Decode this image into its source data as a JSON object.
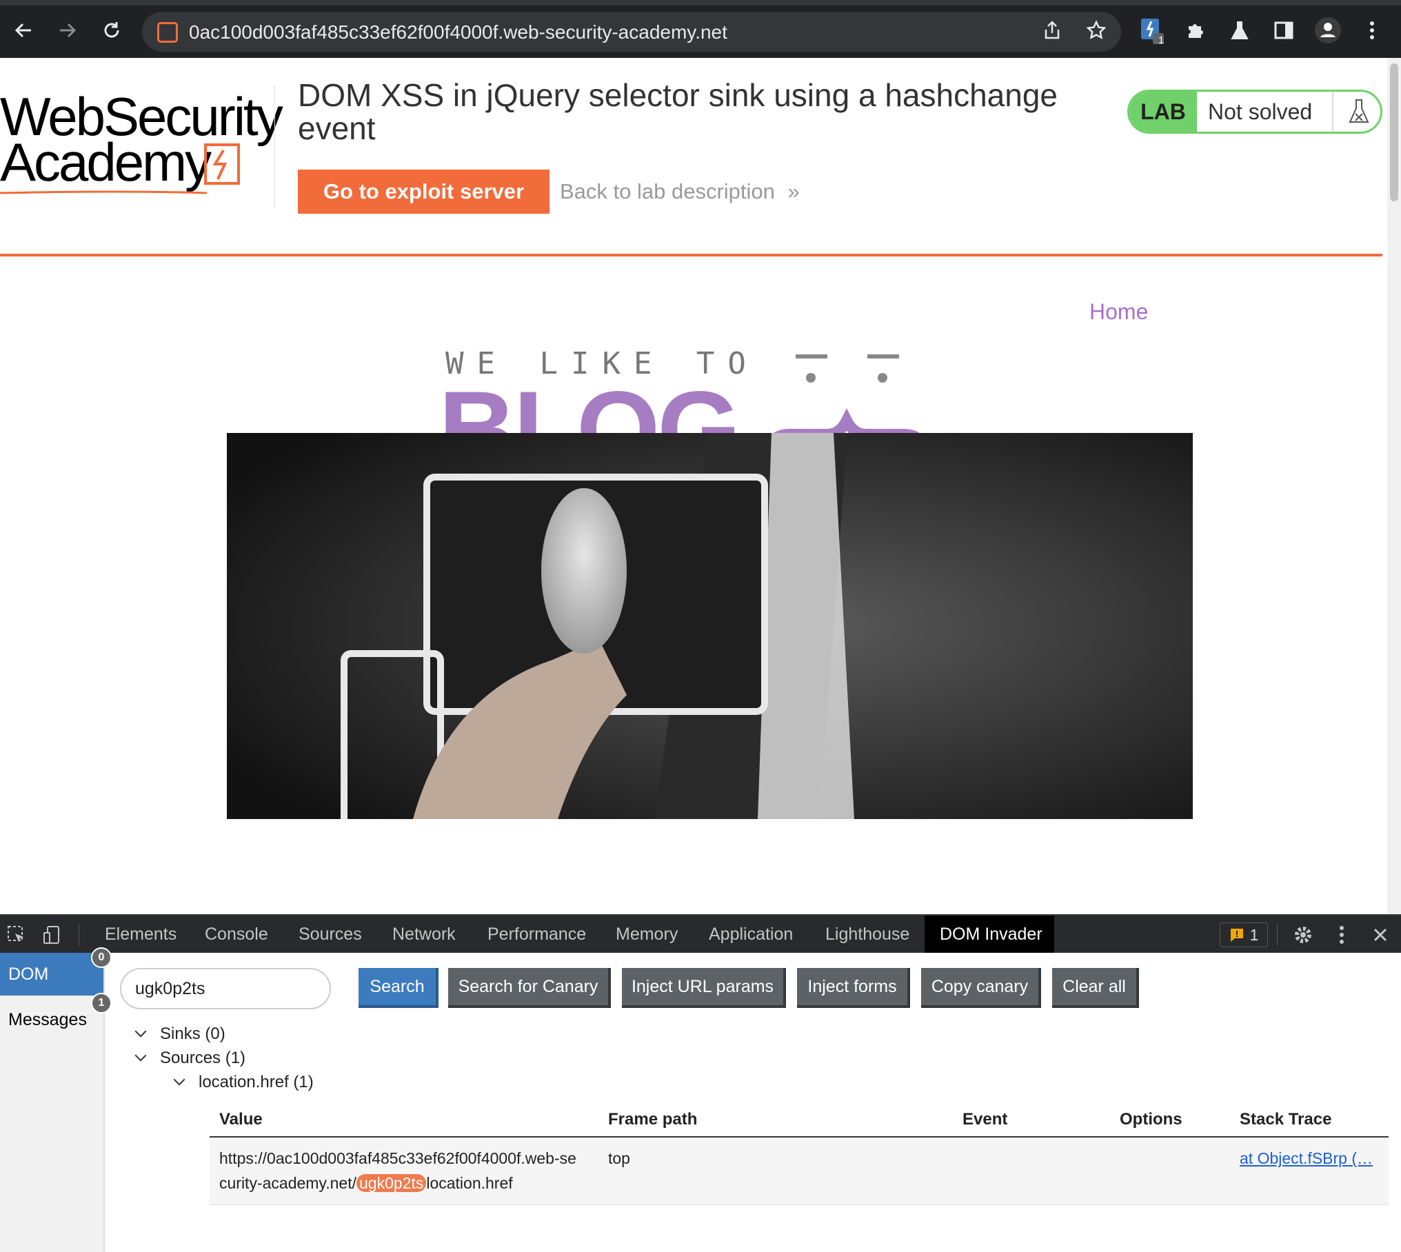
{
  "browser": {
    "url": "0ac100d003faf485c33ef62f00f4000f.web-security-academy.net",
    "extension_badge": "1",
    "icons": [
      "back-icon",
      "forward-icon",
      "reload-icon",
      "share-icon",
      "star-icon",
      "extension-icon",
      "puzzle-icon",
      "flask-icon",
      "sidepanel-icon",
      "profile-icon",
      "menu-icon"
    ]
  },
  "header": {
    "logo_line1": "WebSecurity",
    "logo_line2": "Academy",
    "lab_title": "DOM XSS in jQuery selector sink using a hashchange event",
    "exploit_button": "Go to exploit server",
    "back_link": "Back to lab description",
    "back_link_icon": "»",
    "lab_badge": "LAB",
    "lab_state": "Not solved"
  },
  "blog": {
    "nav_home": "Home",
    "tagline_small": "WE LIKE TO",
    "tagline_big": "BLOG"
  },
  "devtools": {
    "tabs": [
      "Elements",
      "Console",
      "Sources",
      "Network",
      "Performance",
      "Memory",
      "Application",
      "Lighthouse",
      "DOM Invader"
    ],
    "active_tab": "DOM Invader",
    "issues_count": "1",
    "sidebar": [
      {
        "label": "DOM",
        "count": "0"
      },
      {
        "label": "Messages",
        "count": "1"
      }
    ],
    "canary_value": "ugk0p2ts",
    "buttons": {
      "search": "Search",
      "search_canary": "Search for Canary",
      "inject_url": "Inject URL params",
      "inject_forms": "Inject forms",
      "copy_canary": "Copy canary",
      "clear_all": "Clear all"
    },
    "tree": {
      "sinks": "Sinks (0)",
      "sources": "Sources (1)",
      "location_href": "location.href (1)"
    },
    "columns": [
      "Value",
      "Frame path",
      "Event",
      "Options",
      "Stack Trace"
    ],
    "row": {
      "value_line1": "https://0ac100d003faf485c33ef62f00f4000f.web-se",
      "value_line2_prefix": "curity-academy.net/",
      "value_highlight": "ugk0p2ts",
      "value_line2_suffix": "location.href",
      "frame_path": "top",
      "event": "",
      "options": "",
      "stack_trace": "at Object.fSBrp (…"
    }
  },
  "colors": {
    "accent_orange": "#f26b3a",
    "blog_purple": "#a67dc3",
    "lab_green": "#70d16b",
    "devtools_blue": "#3d7bbf"
  }
}
